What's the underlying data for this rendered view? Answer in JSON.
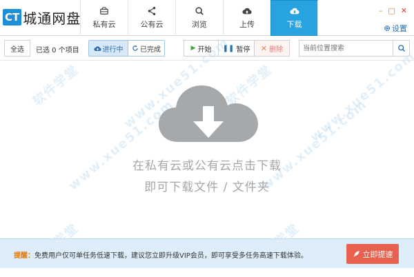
{
  "app": {
    "logo_badge": "CT",
    "logo_text": "城通网盘"
  },
  "nav": {
    "tabs": [
      {
        "label": "私有云",
        "icon": "drive-icon"
      },
      {
        "label": "公有云",
        "icon": "share-icon"
      },
      {
        "label": "浏览",
        "icon": "search-icon"
      },
      {
        "label": "上传",
        "icon": "cloud-upload-icon"
      },
      {
        "label": "下载",
        "icon": "cloud-download-icon",
        "active": true
      }
    ]
  },
  "window": {
    "minimize": "–",
    "maximize": "□",
    "close": "✕"
  },
  "settings_label": "设置",
  "toolbar": {
    "select_all": "全选",
    "selected_info": "已选 0 个项目",
    "in_progress": "进行中",
    "completed": "已完成",
    "start": "开始",
    "pause": "暂停",
    "delete": "删除",
    "search_placeholder": "当前位置搜索"
  },
  "empty": {
    "line1": "在私有云或公有云点击下载",
    "line2": "即可下载文件 / 文件夹"
  },
  "notice": {
    "prefix": "提醒：",
    "text": "免费用户仅可单任务低速下载，建议您立即升级VIP会员，即可享受多任务高速下载体验。",
    "button": "立即提速"
  },
  "colors": {
    "accent": "#27a3e2",
    "speed_button": "#e8614f",
    "notice_bg": "#ddeefa"
  }
}
